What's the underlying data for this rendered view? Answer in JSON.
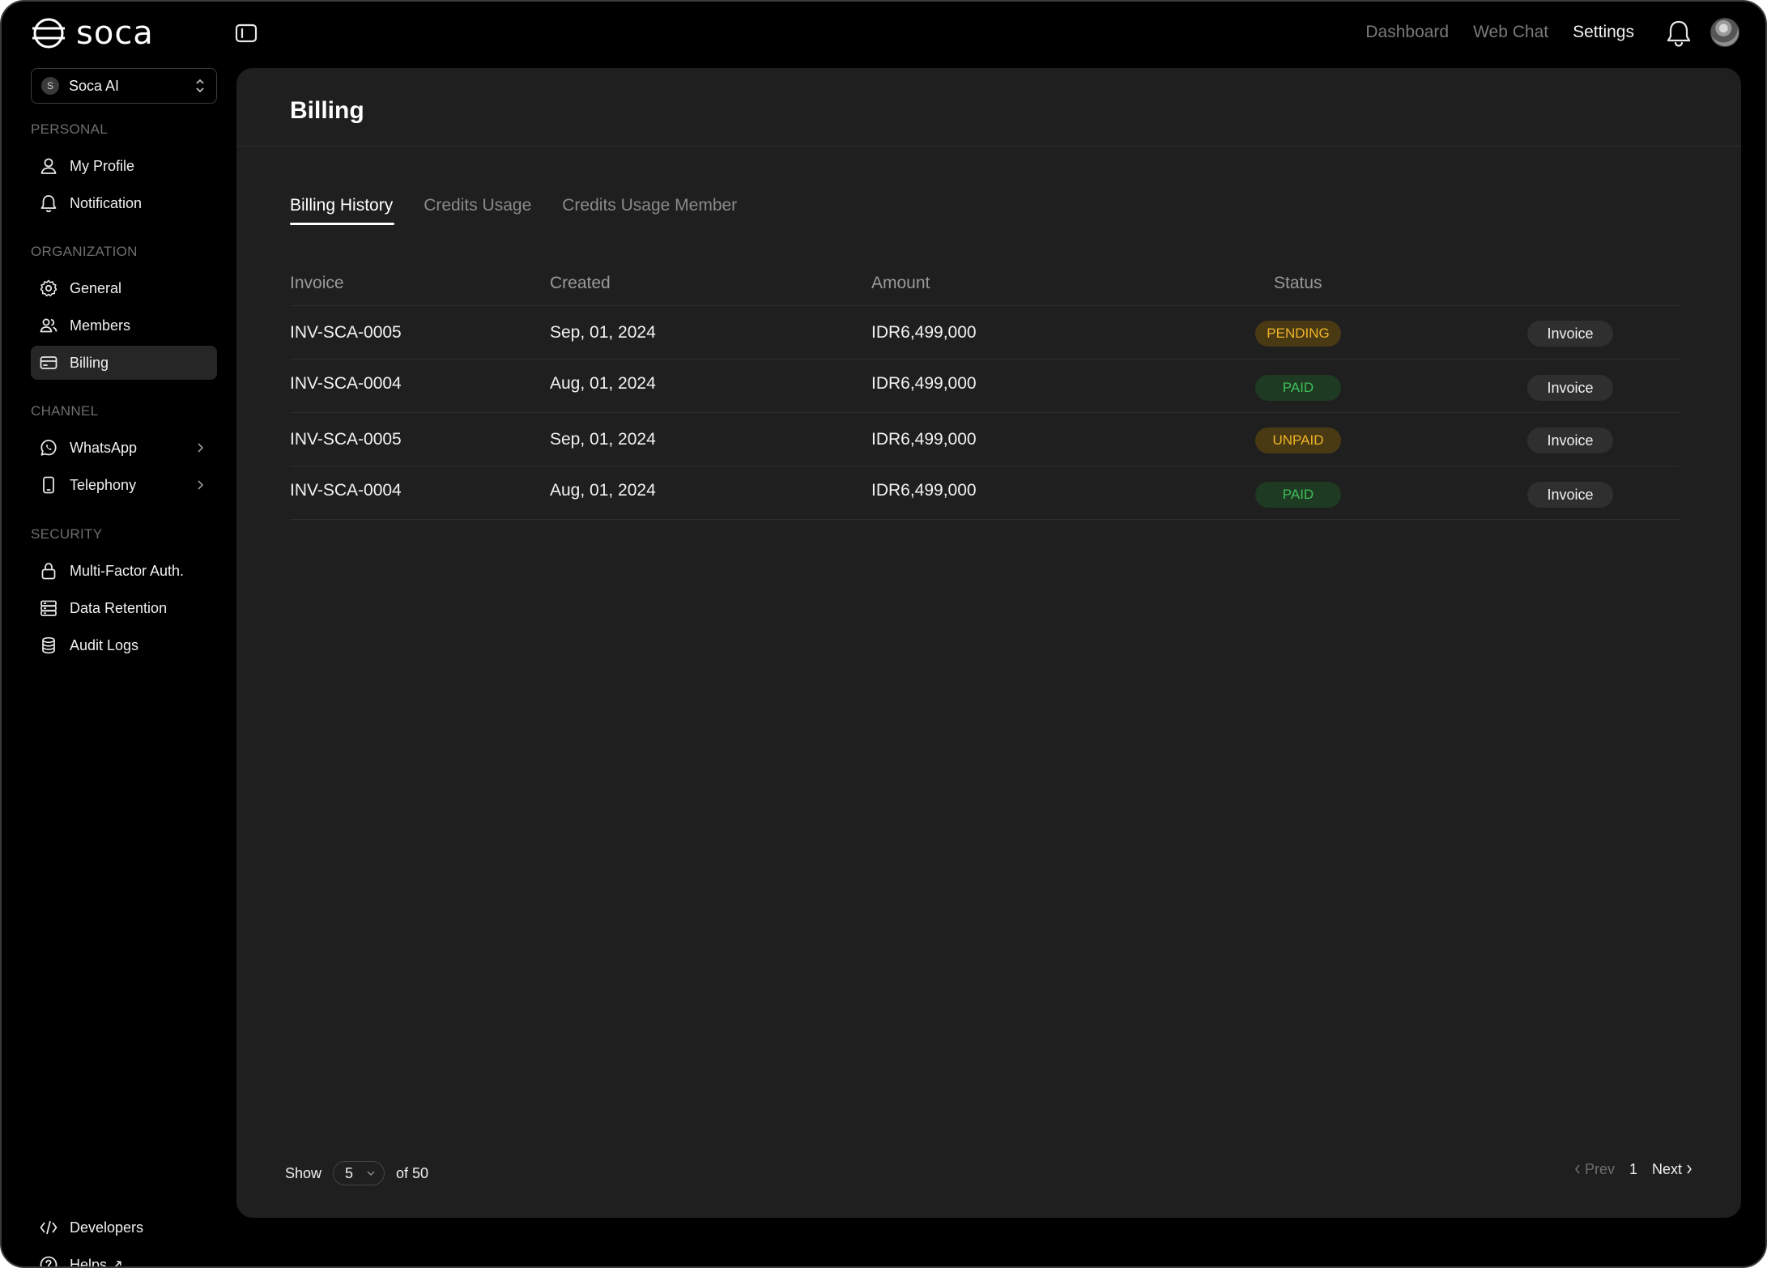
{
  "brand": {
    "name": "soca"
  },
  "topnav": {
    "items": [
      "Dashboard",
      "Web Chat",
      "Settings"
    ],
    "active": "Settings"
  },
  "sidebar": {
    "org": {
      "initial": "S",
      "name": "Soca AI"
    },
    "sections": {
      "personal": "PERSONAL",
      "organization": "ORGANIZATION",
      "channel": "CHANNEL",
      "security": "SECURITY"
    },
    "items": {
      "my_profile": "My Profile",
      "notification": "Notification",
      "general": "General",
      "members": "Members",
      "billing": "Billing",
      "whatsapp": "WhatsApp",
      "telephony": "Telephony",
      "mfa": "Multi-Factor Auth.",
      "data_retention": "Data Retention",
      "audit_logs": "Audit Logs",
      "developers": "Developers",
      "helps": "Helps ↗"
    },
    "selected": "billing"
  },
  "main": {
    "title": "Billing",
    "tabs": [
      "Billing History",
      "Credits Usage",
      "Credits Usage Member"
    ],
    "active_tab": "Billing History",
    "table": {
      "headers": [
        "Invoice",
        "Created",
        "Amount",
        "Status"
      ],
      "rows": [
        {
          "invoice": "INV-SCA-0005",
          "created": "Sep, 01, 2024",
          "amount": "IDR6,499,000",
          "status": "PENDING",
          "action": "Invoice"
        },
        {
          "invoice": "INV-SCA-0004",
          "created": "Aug, 01, 2024",
          "amount": "IDR6,499,000",
          "status": "PAID",
          "action": "Invoice"
        },
        {
          "invoice": "INV-SCA-0005",
          "created": "Sep, 01, 2024",
          "amount": "IDR6,499,000",
          "status": "UNPAID",
          "action": "Invoice"
        },
        {
          "invoice": "INV-SCA-0004",
          "created": "Aug, 01, 2024",
          "amount": "IDR6,499,000",
          "status": "PAID",
          "action": "Invoice"
        }
      ]
    },
    "pagination": {
      "show_label": "Show",
      "page_size": "5",
      "of_label": "of 50",
      "prev": "Prev",
      "page": "1",
      "next": "Next"
    }
  },
  "colors": {
    "pending_bg": "#4a3a14",
    "pending_fg": "#f0b429",
    "paid_bg": "#1f3a22",
    "paid_fg": "#3fbf5a",
    "unpaid_bg": "#4a3a14",
    "unpaid_fg": "#f0b429"
  }
}
